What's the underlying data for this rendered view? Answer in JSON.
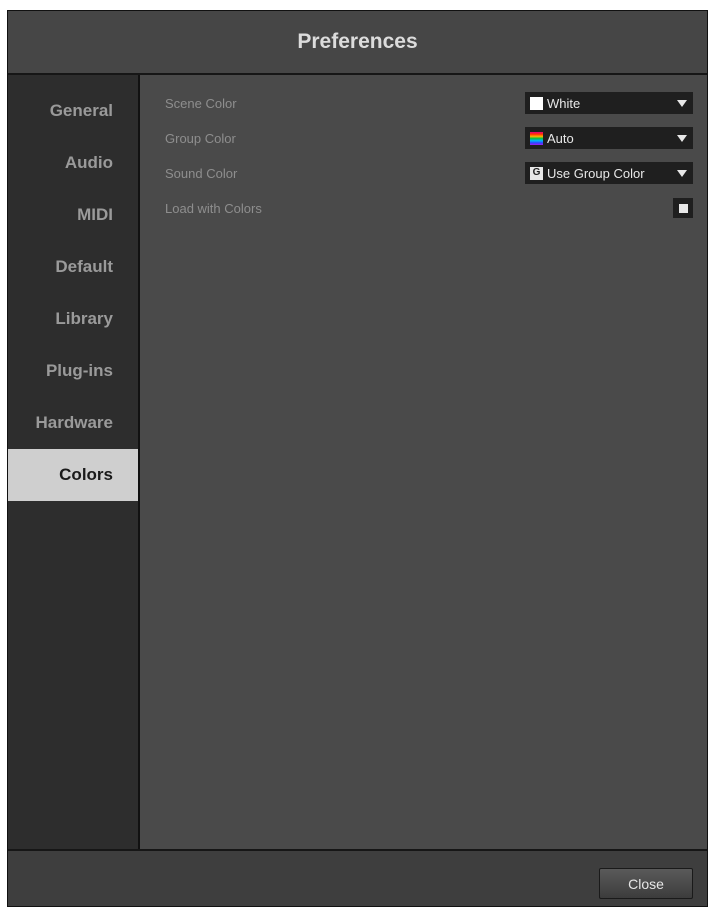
{
  "window": {
    "title": "Preferences"
  },
  "sidebar": {
    "items": [
      {
        "label": "General",
        "active": false
      },
      {
        "label": "Audio",
        "active": false
      },
      {
        "label": "MIDI",
        "active": false
      },
      {
        "label": "Default",
        "active": false
      },
      {
        "label": "Library",
        "active": false
      },
      {
        "label": "Plug-ins",
        "active": false
      },
      {
        "label": "Hardware",
        "active": false
      },
      {
        "label": "Colors",
        "active": true
      }
    ]
  },
  "settings": {
    "scene_color": {
      "label": "Scene Color",
      "value": "White",
      "swatch": "#ffffff"
    },
    "group_color": {
      "label": "Group Color",
      "value": "Auto",
      "swatch": "rainbow"
    },
    "sound_color": {
      "label": "Sound Color",
      "value": "Use Group Color",
      "swatch_glyph": "G"
    },
    "load_with_colors": {
      "label": "Load with Colors",
      "checked": true
    }
  },
  "footer": {
    "close_label": "Close"
  },
  "colors": {
    "active_tab_bg": "#cfcfcf",
    "panel_bg": "#4a4a4a",
    "sidebar_bg": "#2d2d2d"
  }
}
